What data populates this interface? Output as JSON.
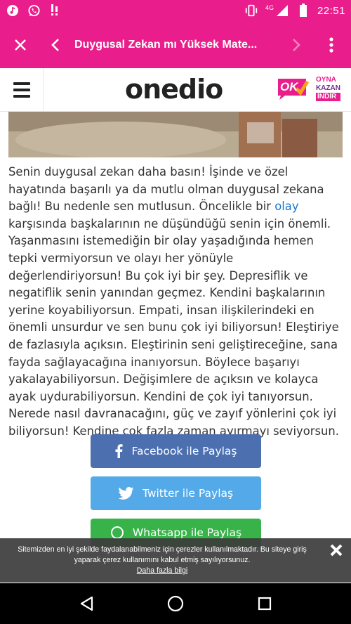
{
  "status_bar": {
    "time": "22:51",
    "network": "4G",
    "icons": [
      "music-icon",
      "whatsapp-icon",
      "notification-icon",
      "vibrate-icon",
      "signal-icon",
      "battery-icon"
    ]
  },
  "toolbar": {
    "title": "Duygusal Zekan mı Yüksek Mate...",
    "close_icon": "close-icon",
    "back_icon": "chevron-left-icon",
    "forward_icon": "chevron-right-icon",
    "menu_icon": "more-vert-icon"
  },
  "site_header": {
    "logo": "onedio",
    "ok_badge_text": "OK",
    "ok_lines": [
      "OYNA",
      "KAZAN",
      "İNDİR"
    ]
  },
  "article": {
    "text_before_link": "Senin duygusal zekan daha basın! İşinde ve özel hayatında başarılı ya da mutlu olman duygusal zekana bağlı! Bu nedenle sen mutlusun. Öncelikle bir ",
    "link_text": "olay",
    "text_after_link": " karşısında başkalarının ne düşündüğü senin için önemli. Yaşanmasını istemediğin bir olay yaşadığında hemen tepki vermiyorsun ve olayı her yönüyle değerlendiriyorsun! Bu çok iyi bir şey. Depresiflik ve negatiflik senin yanından geçmez. Kendini başkalarının yerine koyabiliyorsun. Empati, insan ilişkilerindeki en önemli unsurdur ve sen bunu çok iyi biliyorsun! Eleştiriye de fazlasıyla açıksın. Eleştirinin seni geliştireceğine, sana fayda sağlayacağına inanıyorsun. Böylece başarıyı yakalayabiliyorsun. Değişimlere de açıksın ve kolayca ayak uydurabiliyorsun. Kendini de çok iyi tanıyorsun. Nerede nasıl davranacağını, güç ve zayıf yönlerini çok iyi biliyorsun! Kendine çok fazla zaman ayırmayı seviyorsun."
  },
  "share": {
    "facebook": "Facebook ile Paylaş",
    "twitter": "Twitter ile Paylaş",
    "whatsapp": "Whatsapp ile Paylaş"
  },
  "cookie_banner": {
    "message": "Sitemizden en iyi şekilde faydalanabilmeniz için çerezler kullanılmaktadır. Bu siteye giriş yaparak çerez kullanımını kabul etmiş sayılıyorsunuz.",
    "link": "Daha fazla bilgi"
  },
  "colors": {
    "brand_pink": "#e91e8c",
    "facebook": "#4c6fb0",
    "twitter": "#54a9e9",
    "whatsapp": "#38b349",
    "link": "#1976d2"
  }
}
